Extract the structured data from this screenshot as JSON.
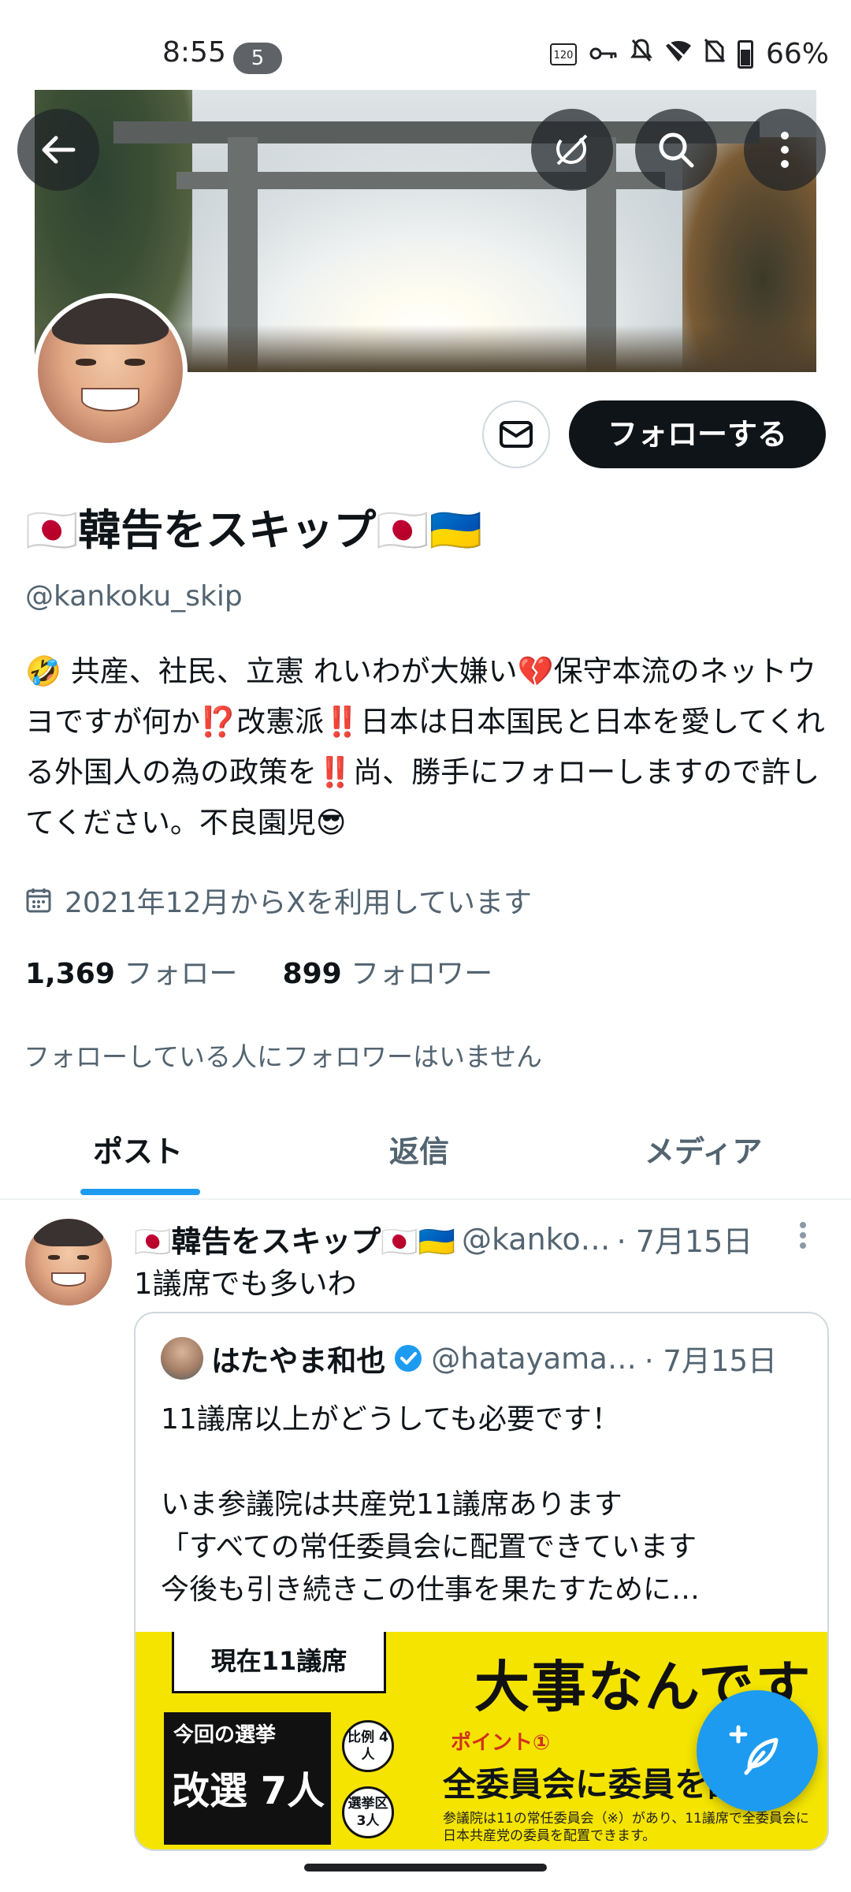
{
  "status_bar": {
    "time": "8:55",
    "notification_count": "5",
    "refresh_rate": "120",
    "battery_percent": "66%"
  },
  "profile": {
    "display_name": "🇯🇵韓告をスキップ🇯🇵🇺🇦",
    "handle": "@kankoku_skip",
    "bio": "🤣 共産、社民、立憲 れいわが大嫌い💔保守本流のネットウヨですが何か⁉️改憲派‼️日本は日本国民と日本を愛してくれる外国人の為の政策を‼️尚、勝手にフォローしますので許してください。不良園児😎",
    "joined": "2021年12月からXを利用しています",
    "following_count": "1,369",
    "following_label": "フォロー",
    "followers_count": "899",
    "followers_label": "フォロワー",
    "followed_by_text": "フォローしている人にフォロワーはいません",
    "follow_button": "フォローする"
  },
  "tabs": [
    {
      "label": "ポスト",
      "active": true
    },
    {
      "label": "返信",
      "active": false
    },
    {
      "label": "メディア",
      "active": false
    }
  ],
  "tweet": {
    "name": "🇯🇵韓告をスキップ🇯🇵🇺🇦",
    "handle": "@kanko…",
    "date": "· 7月15日",
    "text": "1議席でも多いわ",
    "quote": {
      "name": "はたやま和也",
      "handle": "@hatayama…",
      "date": "· 7月15日",
      "line1": "11議席以上がどうしても必要です！",
      "line2": "いま参議院は共産党11議席あります",
      "line3": "「すべての常任委員会に配置できています",
      "line4": "今後も引き続きこの仕事を果たすために…",
      "image": {
        "current": "現在11議席",
        "election_label": "今回の選挙",
        "reelection": "改選 7人",
        "proportional": "比例 4人",
        "district": "選挙区 3人",
        "headline": "大事なんです",
        "point": "ポイント①",
        "subhead": "全委員会に委員を配",
        "small_text_1": "参議院は11の常任委員会（※）があり、11議席で全委員会に",
        "small_text_2": "日本共産党の委員を配置できます。"
      }
    }
  },
  "icons": {
    "back": "arrow-left-icon",
    "grok": "grok-icon",
    "search": "search-icon",
    "more": "more-vertical-icon",
    "message": "envelope-icon",
    "calendar": "calendar-icon",
    "verified": "verified-badge-icon",
    "compose": "compose-plus-icon"
  },
  "colors": {
    "accent": "#1d9bf0",
    "text": "#0f1419",
    "secondary_text": "#536471",
    "follow_button_bg": "#0f1419"
  }
}
